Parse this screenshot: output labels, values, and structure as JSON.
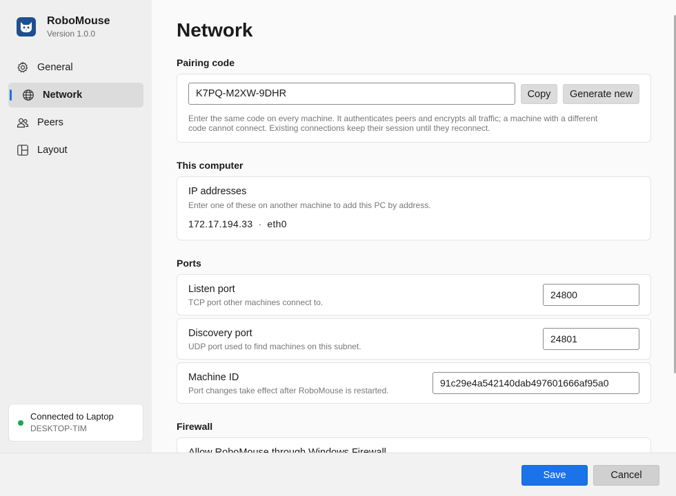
{
  "app": {
    "name": "RoboMouse",
    "version": "Version 1.0.0",
    "logo_icon": "cat-face-icon",
    "accent": "#1a73e8"
  },
  "sidebar": {
    "items": [
      {
        "label": "General",
        "icon": "gear-icon",
        "active": false
      },
      {
        "label": "Network",
        "icon": "globe-icon",
        "active": true
      },
      {
        "label": "Peers",
        "icon": "people-icon",
        "active": false
      },
      {
        "label": "Layout",
        "icon": "grid-layout-icon",
        "active": false
      }
    ],
    "status": {
      "title": "Connected to Laptop",
      "subtitle": "DESKTOP-TIM",
      "color": "#21a453"
    }
  },
  "main": {
    "title": "Network",
    "pairing": {
      "section_label": "Pairing code",
      "code": "K7PQ-M2XW-9DHR",
      "copy_label": "Copy",
      "generate_label": "Generate new",
      "helper_line1": "Enter the same code on every machine. It authenticates peers and encrypts all traffic; a machine with a different",
      "helper_line2": "code cannot connect. Existing connections keep their session until they reconnect."
    },
    "this_computer": {
      "section_label": "This computer",
      "title": "IP addresses",
      "subtitle": "Enter one of these on another machine to add this PC by address.",
      "ip": "172.17.194.33",
      "separator": "·",
      "interface": "eth0"
    },
    "ports": {
      "section_label": "Ports",
      "listen": {
        "title": "Listen port",
        "subtitle": "TCP port other machines connect to.",
        "value": "24800"
      },
      "discovery": {
        "title": "Discovery port",
        "subtitle": "UDP port used to find machines on this subnet.",
        "value": "24801"
      },
      "machine_id": {
        "title": "Machine ID",
        "subtitle": "Port changes take effect after RoboMouse is restarted.",
        "value": "91c29e4a542140dab497601666af95a0"
      }
    },
    "firewall": {
      "section_label": "Firewall",
      "row_title": "Allow RoboMouse through Windows Firewall"
    }
  },
  "footer": {
    "save_label": "Save",
    "cancel_label": "Cancel"
  }
}
